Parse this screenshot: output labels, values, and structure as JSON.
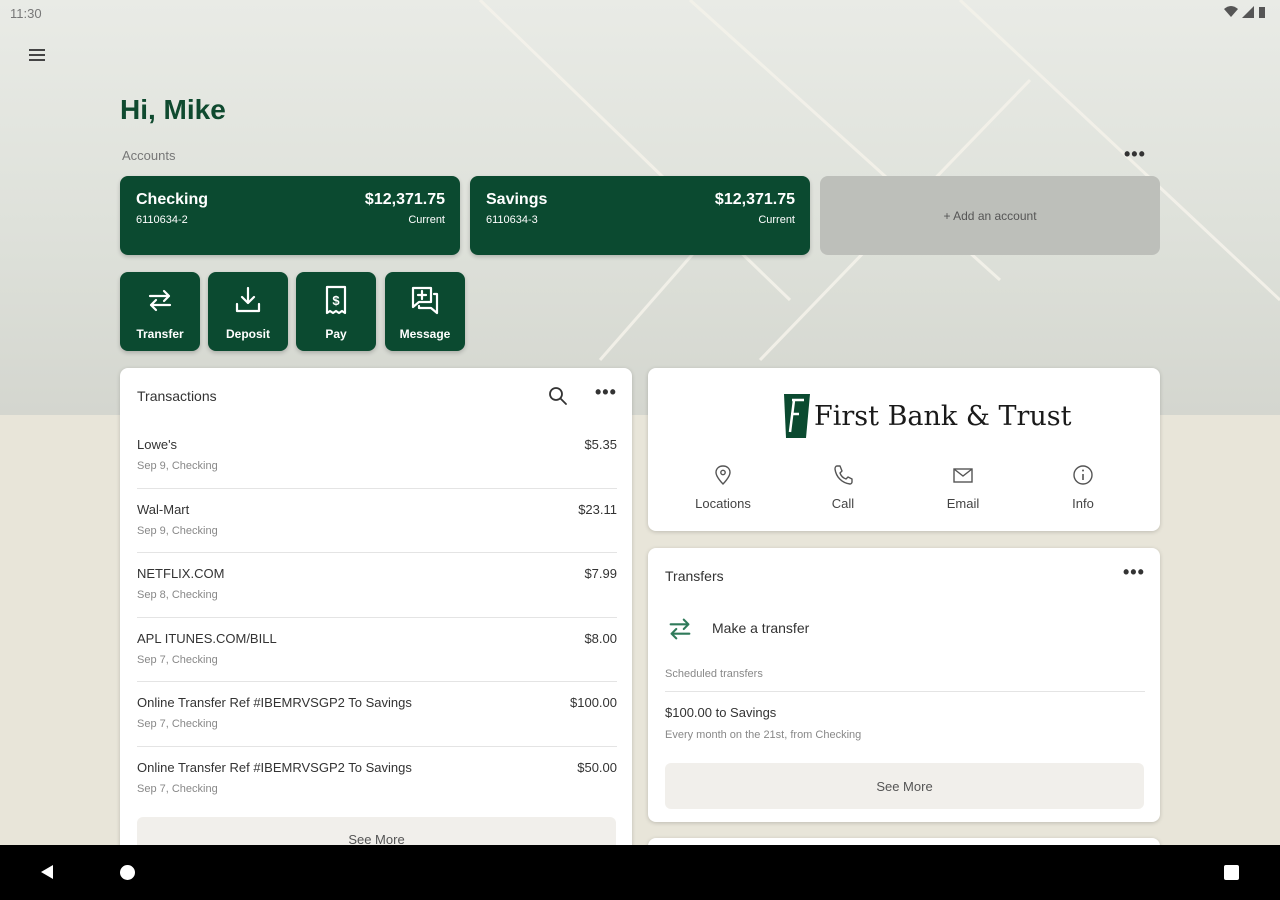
{
  "status_bar": {
    "time": "11:30"
  },
  "greeting": "Hi, Mike",
  "accounts": {
    "label": "Accounts",
    "more": "•••",
    "items": [
      {
        "name": "Checking",
        "number": "6110634-2",
        "balance": "$12,371.75",
        "status": "Current"
      },
      {
        "name": "Savings",
        "number": "6110634-3",
        "balance": "$12,371.75",
        "status": "Current"
      }
    ],
    "add_label": "+ Add an account"
  },
  "actions": [
    {
      "label": "Transfer",
      "icon": "transfer-icon"
    },
    {
      "label": "Deposit",
      "icon": "deposit-icon"
    },
    {
      "label": "Pay",
      "icon": "pay-icon"
    },
    {
      "label": "Message",
      "icon": "message-icon"
    }
  ],
  "transactions": {
    "title": "Transactions",
    "more": "•••",
    "items": [
      {
        "name": "Lowe's",
        "meta": "Sep 9, Checking",
        "amount": "$5.35"
      },
      {
        "name": "Wal-Mart",
        "meta": "Sep 9, Checking",
        "amount": "$23.11"
      },
      {
        "name": "NETFLIX.COM",
        "meta": "Sep 8, Checking",
        "amount": "$7.99"
      },
      {
        "name": "APL ITUNES.COM/BILL",
        "meta": "Sep 7, Checking",
        "amount": "$8.00"
      },
      {
        "name": "Online Transfer Ref #IBEMRVSGP2 To Savings",
        "meta": "Sep 7, Checking",
        "amount": "$100.00"
      },
      {
        "name": "Online Transfer Ref #IBEMRVSGP2 To Savings",
        "meta": "Sep 7, Checking",
        "amount": "$50.00"
      }
    ],
    "see_more": "See More"
  },
  "bank": {
    "name": "First Bank & Trust",
    "actions": [
      {
        "label": "Locations",
        "icon": "location-pin-icon"
      },
      {
        "label": "Call",
        "icon": "phone-icon"
      },
      {
        "label": "Email",
        "icon": "email-icon"
      },
      {
        "label": "Info",
        "icon": "info-icon"
      }
    ]
  },
  "transfers": {
    "title": "Transfers",
    "more": "•••",
    "make_transfer": "Make a transfer",
    "scheduled_label": "Scheduled transfers",
    "scheduled": [
      {
        "title": "$100.00 to Savings",
        "subtitle": "Every month on the 21st, from Checking"
      }
    ],
    "see_more": "See More"
  },
  "colors": {
    "brand_green": "#0b4a30",
    "greeting_green": "#0f4a2f",
    "background": "#e8e5d9"
  }
}
